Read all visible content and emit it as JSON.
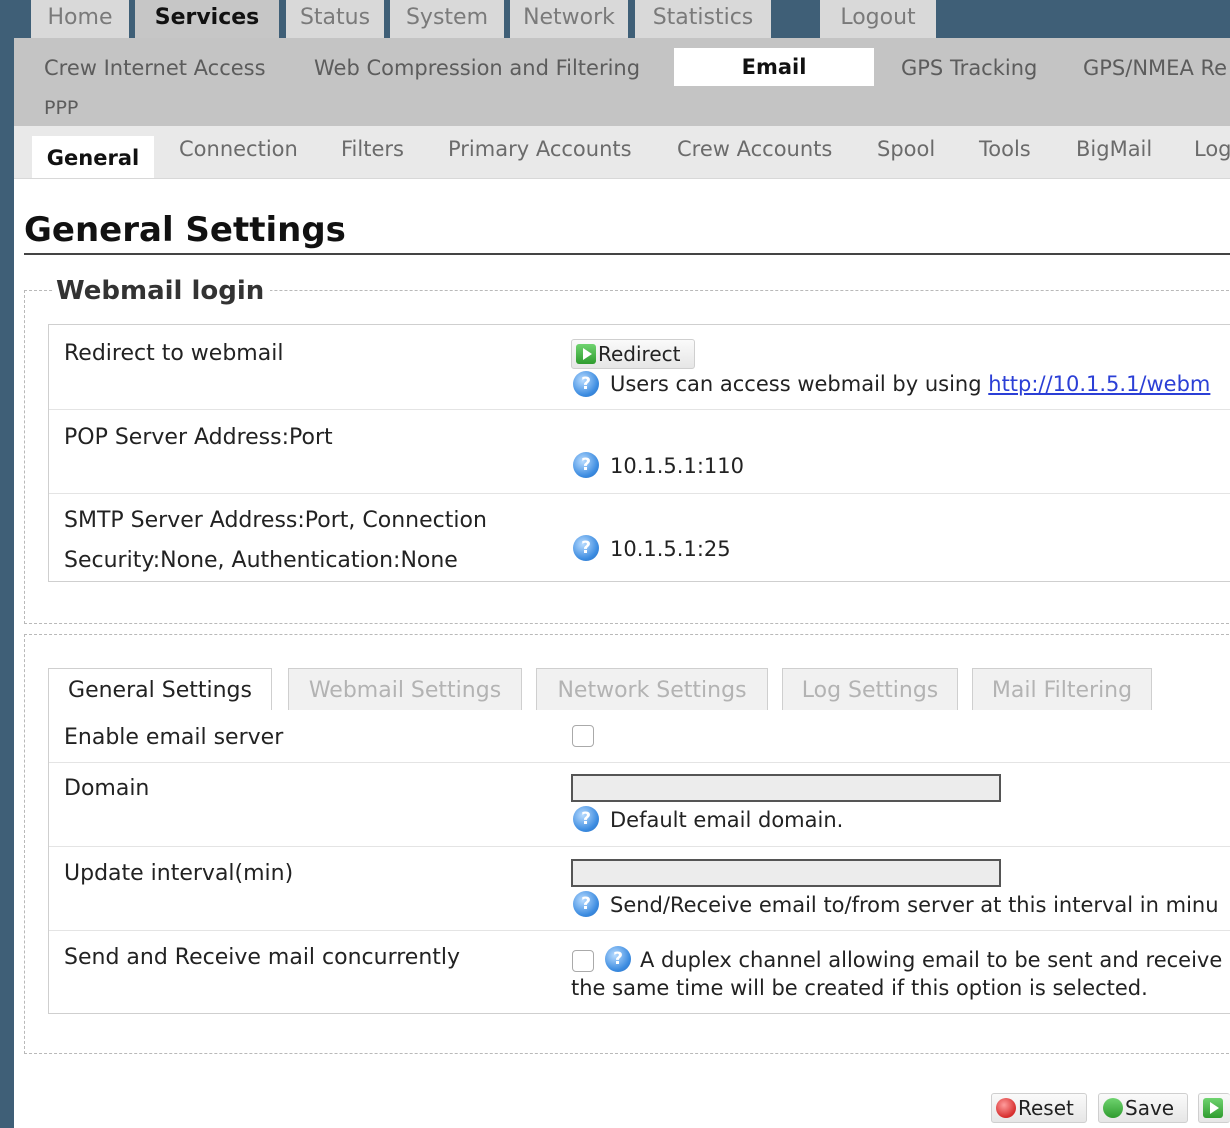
{
  "top_nav": {
    "items": [
      "Home",
      "Services",
      "Status",
      "System",
      "Network",
      "Statistics",
      "Logout"
    ],
    "active": "Services"
  },
  "sub_nav": {
    "items": [
      "Crew Internet Access",
      "Web Compression and Filtering",
      "Email",
      "GPS Tracking",
      "GPS/NMEA Re",
      "PPP"
    ],
    "active": "Email"
  },
  "tert_nav": {
    "items": [
      "General",
      "Connection",
      "Filters",
      "Primary Accounts",
      "Crew Accounts",
      "Spool",
      "Tools",
      "BigMail",
      "Log"
    ],
    "active": "General"
  },
  "page": {
    "title": "General Settings"
  },
  "webmail_login": {
    "legend": "Webmail login",
    "redirect_label": "Redirect to webmail",
    "redirect_button": "Redirect",
    "redirect_help_text": "Users can access webmail by using",
    "redirect_link": "http://10.1.5.1/webm",
    "pop_label": "POP Server Address:Port",
    "pop_value": "10.1.5.1:110",
    "smtp_label_line1": "SMTP Server Address:Port, Connection",
    "smtp_label_line2": "Security:None, Authentication:None",
    "smtp_value": "10.1.5.1:25",
    "help_glyph": "?"
  },
  "settings_tabs": [
    "General Settings",
    "Webmail Settings",
    "Network Settings",
    "Log Settings",
    "Mail Filtering"
  ],
  "general_settings": {
    "enable_label": "Enable email server",
    "enable_checked": false,
    "domain_label": "Domain",
    "domain_value": "",
    "domain_help": "Default email domain.",
    "update_label": "Update interval(min)",
    "update_value": "",
    "update_help": "Send/Receive email to/from server at this interval in minu",
    "concurrent_label": "Send and Receive mail concurrently",
    "concurrent_checked": false,
    "concurrent_help_line1": "A duplex channel allowing email to be sent and receive",
    "concurrent_help_line2": "the same time will be created if this option is selected."
  },
  "footer": {
    "reset_label": "Reset",
    "save_label": "Save"
  }
}
